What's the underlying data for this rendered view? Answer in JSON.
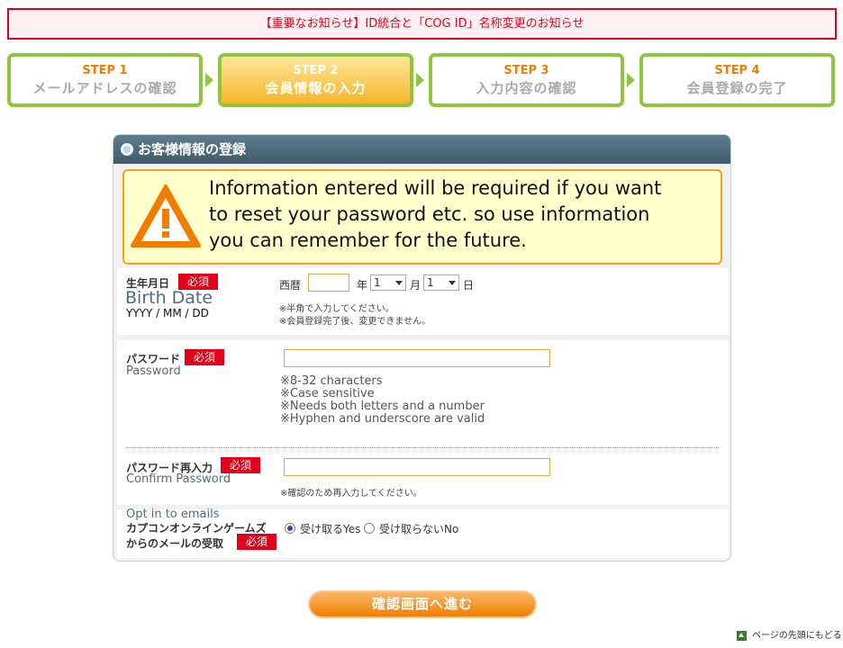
{
  "notice": {
    "text": "【重要なお知らせ】ID統合と「COG ID」名称変更のお知らせ"
  },
  "steps": [
    {
      "num": "STEP 1",
      "label": "メールアドレスの確認"
    },
    {
      "num": "STEP 2",
      "label": "会員情報の入力"
    },
    {
      "num": "STEP 3",
      "label": "入力内容の確認"
    },
    {
      "num": "STEP 4",
      "label": "会員登録の完了"
    }
  ],
  "panel": {
    "title": "お客様情報の登録",
    "warning": "Information entered will be required if you want to reset your password etc. so use information you can remember for the future."
  },
  "required_badge": "必須",
  "birth": {
    "label_jp": "生年月日",
    "label_en": "Birth Date",
    "format": "YYYY / MM / DD",
    "era": "西暦",
    "year_value": "",
    "year_unit": "年",
    "month_value": "1",
    "month_unit": "月",
    "day_value": "1",
    "day_unit": "日",
    "note1": "※半角で入力してください。",
    "note2": "※会員登録完了後、変更できません。"
  },
  "password": {
    "label_jp": "パスワード",
    "label_en": "Password",
    "value": "",
    "rules": [
      "※8-32 characters",
      "※Case sensitive",
      "※Needs both letters and a number",
      "※Hyphen and underscore are valid"
    ]
  },
  "confirm": {
    "label_jp": "パスワード再入力",
    "label_en": "Confirm Password",
    "value": "",
    "note": "※確認のため再入力してください。"
  },
  "optin": {
    "label_en": "Opt in to emails",
    "label_jp1": "カプコンオンラインゲームズ",
    "label_jp2": "からのメールの受取",
    "yes": "受け取るYes",
    "no": "受け取らないNo",
    "selected": "yes"
  },
  "submit_label": "確認画面へ進む",
  "back_to_top": "ページの先頭にもどる",
  "colors": {
    "accent_red": "#e3001b",
    "step_green": "#8ec63f",
    "orange": "#f07d00",
    "header_slate": "#4a6676"
  }
}
